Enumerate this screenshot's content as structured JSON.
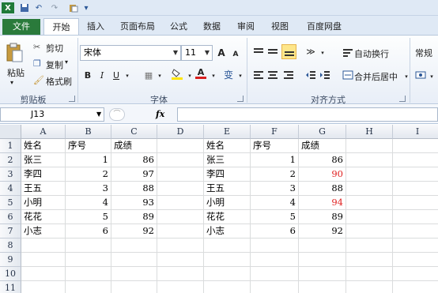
{
  "quick_access": {
    "undo": "↶",
    "redo": "↷",
    "more": "▾"
  },
  "tabs": [
    "文件",
    "开始",
    "插入",
    "页面布局",
    "公式",
    "数据",
    "审阅",
    "视图",
    "百度网盘"
  ],
  "ribbon": {
    "clipboard": {
      "paste": "粘贴",
      "cut": "剪切",
      "copy": "复制",
      "format_painter": "格式刷",
      "group": "剪贴板"
    },
    "font": {
      "name": "宋体",
      "size": "11",
      "bold": "B",
      "italic": "I",
      "underline": "U",
      "grow": "A",
      "shrink": "A",
      "font_color_accent": "#d81e1e",
      "fill_color_accent": "#ffe600",
      "group": "字体"
    },
    "alignment": {
      "wrap": "自动换行",
      "merge": "合并后居中",
      "group": "对齐方式"
    },
    "number": {
      "format": "常规"
    }
  },
  "formula_bar": {
    "name_box": "J13",
    "fx": "fx",
    "value": ""
  },
  "columns": [
    "A",
    "B",
    "C",
    "D",
    "E",
    "F",
    "G",
    "H",
    "I"
  ],
  "rows": [
    "1",
    "2",
    "3",
    "4",
    "5",
    "6",
    "7",
    "8",
    "9",
    "10",
    "11"
  ],
  "table_left": {
    "headers": [
      "姓名",
      "序号",
      "成绩"
    ],
    "rows": [
      [
        "张三",
        "1",
        "86"
      ],
      [
        "李四",
        "2",
        "97"
      ],
      [
        "王五",
        "3",
        "88"
      ],
      [
        "小明",
        "4",
        "93"
      ],
      [
        "花花",
        "5",
        "89"
      ],
      [
        "小志",
        "6",
        "92"
      ]
    ]
  },
  "table_right": {
    "headers": [
      "姓名",
      "序号",
      "成绩"
    ],
    "rows": [
      [
        "张三",
        "1",
        "86"
      ],
      [
        "李四",
        "2",
        "90"
      ],
      [
        "王五",
        "3",
        "88"
      ],
      [
        "小明",
        "4",
        "94"
      ],
      [
        "花花",
        "5",
        "89"
      ],
      [
        "小志",
        "6",
        "92"
      ]
    ],
    "highlight_color": "#e02020",
    "highlighted_rows": [
      1,
      3
    ]
  }
}
